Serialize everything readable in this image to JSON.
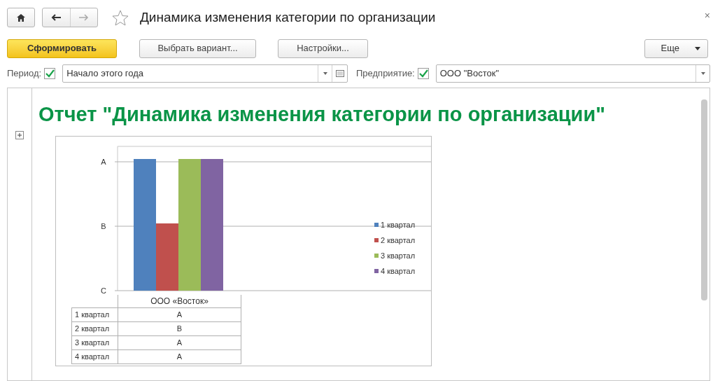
{
  "window": {
    "title": "Динамика изменения категории по организации",
    "close": "×"
  },
  "toolbar": {
    "buttons": [
      {
        "label": "Сформировать",
        "kind": "primary"
      },
      {
        "label": "Выбрать вариант...",
        "kind": "normal"
      },
      {
        "label": "Настройки...",
        "kind": "normal"
      }
    ],
    "more": "Еще"
  },
  "filters": [
    {
      "label": "Период:",
      "checked": true,
      "value": "Начало этого года",
      "calendar": true
    },
    {
      "label": "Предприятие:",
      "checked": true,
      "value": "ООО \"Восток\"",
      "calendar": false
    }
  ],
  "report": {
    "title": "Отчет \"Динамика изменения категории по организации\"",
    "chart": {
      "y_axis_labels": [
        "A",
        "B",
        "C"
      ],
      "series": [
        {
          "name": "1 квартал",
          "color": "#4f81bd"
        },
        {
          "name": "2 квартал",
          "color": "#c0504d"
        },
        {
          "name": "3 квартал",
          "color": "#9bbb59"
        },
        {
          "name": "4 квартал",
          "color": "#8064a2"
        }
      ]
    },
    "table": {
      "header": "ООО «Восток»",
      "rows": [
        {
          "label": "1 квартал",
          "value": "A"
        },
        {
          "label": "2 квартал",
          "value": "B"
        },
        {
          "label": "3 квартал",
          "value": "A"
        },
        {
          "label": "4 квартал",
          "value": "A"
        }
      ]
    }
  }
}
